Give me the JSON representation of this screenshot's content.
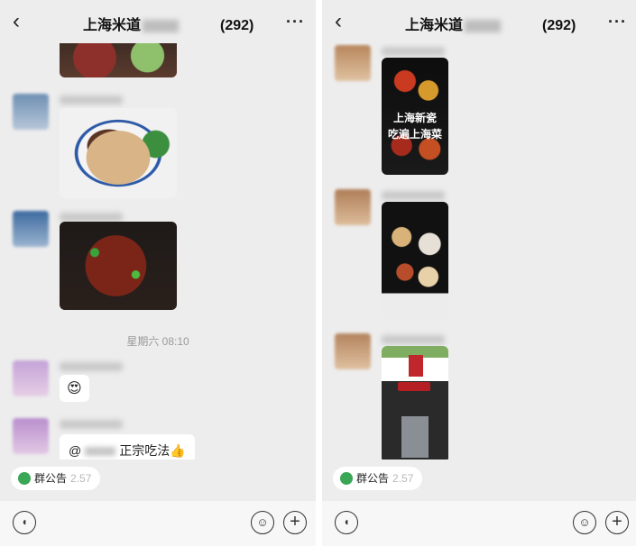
{
  "left_screen": {
    "header": {
      "back_icon": "chevron-left-icon",
      "title": "上海米道",
      "member_count": "(292)",
      "more_icon": "ellipsis-icon"
    },
    "timestamp": "星期六 08:10",
    "emoji_message": "😍",
    "mention_message": {
      "at": "@",
      "text": "正宗吃法",
      "emoji": "👍"
    },
    "notice": {
      "label": "群公告",
      "extra": "2.57"
    },
    "input_bar": {
      "voice_icon": "voice-icon",
      "emoji_icon": "emoji-icon",
      "plus_icon": "plus-icon"
    }
  },
  "right_screen": {
    "header": {
      "back_icon": "chevron-left-icon",
      "title": "上海米道",
      "member_count": "(292)",
      "more_icon": "ellipsis-icon"
    },
    "menu_image_text": [
      "上海新瓷",
      "吃遍上海菜"
    ],
    "notice": {
      "label": "群公告",
      "extra": "2.57"
    },
    "input_bar": {
      "voice_icon": "voice-icon",
      "emoji_icon": "emoji-icon",
      "plus_icon": "plus-icon"
    }
  },
  "colors": {
    "background": "#ededed",
    "bubble": "#ffffff",
    "notice_dot": "#3aa757"
  }
}
